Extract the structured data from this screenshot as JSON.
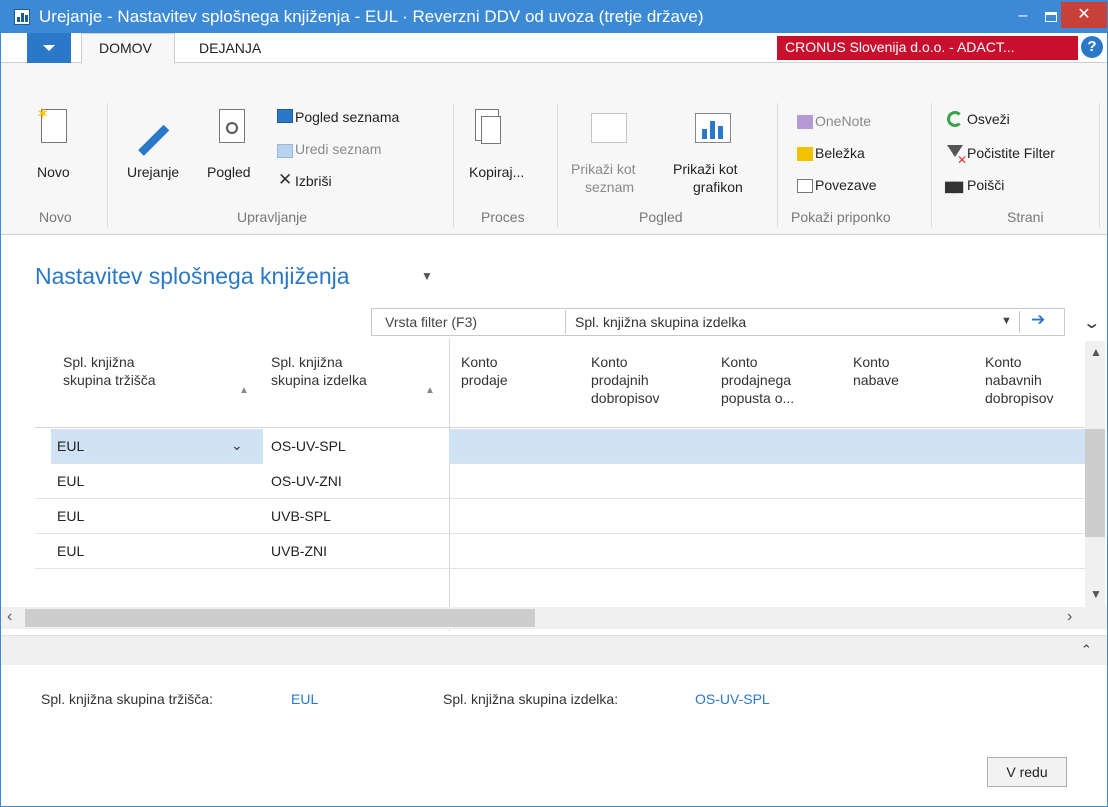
{
  "window": {
    "title": "Urejanje - Nastavitev splošnega knjiženja - EUL · Reverzni DDV od uvoza (tretje države)",
    "minimize": "–",
    "close": "✕"
  },
  "tabs": {
    "home": "DOMOV",
    "actions": "DEJANJA"
  },
  "company": "CRONUS Slovenija d.o.o. - ADACT...",
  "help": "?",
  "ribbon": {
    "new": "Novo",
    "edit": "Urejanje",
    "view": "Pogled",
    "list_view": "Pogled seznama",
    "edit_list": "Uredi seznam",
    "delete": "Izbriši",
    "copy": "Kopiraj...",
    "show_list_1": "Prikaži kot",
    "show_list_2": "seznam",
    "show_chart_1": "Prikaži kot",
    "show_chart_2": "grafikon",
    "onenote": "OneNote",
    "note": "Beležka",
    "links": "Povezave",
    "refresh": "Osveži",
    "clear_filter": "Počistite Filter",
    "find": "Poišči",
    "groups": {
      "new": "Novo",
      "manage": "Upravljanje",
      "process": "Proces",
      "view": "Pogled",
      "attachments": "Pokaži priponko",
      "page": "Strani"
    }
  },
  "page_title": "Nastavitev splošnega knjiženja",
  "filter": {
    "placeholder": "Vrsta filter (F3)",
    "field": "Spl. knjižna skupina izdelka"
  },
  "columns": [
    {
      "l1": "Spl. knjižna",
      "l2": "skupina tržišča",
      "l3": ""
    },
    {
      "l1": "Spl. knjižna",
      "l2": "skupina izdelka",
      "l3": ""
    },
    {
      "l1": "Konto",
      "l2": "prodaje",
      "l3": ""
    },
    {
      "l1": "Konto",
      "l2": "prodajnih",
      "l3": "dobropisov"
    },
    {
      "l1": "Konto",
      "l2": "prodajnega",
      "l3": "popusta o..."
    },
    {
      "l1": "Konto",
      "l2": "nabave",
      "l3": ""
    },
    {
      "l1": "Konto",
      "l2": "nabavnih",
      "l3": "dobropisov"
    }
  ],
  "rows": [
    {
      "market": "EUL",
      "product": "OS-UV-SPL"
    },
    {
      "market": "EUL",
      "product": "OS-UV-ZNI"
    },
    {
      "market": "EUL",
      "product": "UVB-SPL"
    },
    {
      "market": "EUL",
      "product": "UVB-ZNI"
    }
  ],
  "details": {
    "market_label": "Spl. knjižna skupina tržišča:",
    "market_value": "EUL",
    "product_label": "Spl. knjižna skupina izdelka:",
    "product_value": "OS-UV-SPL"
  },
  "ok_button": "V redu"
}
